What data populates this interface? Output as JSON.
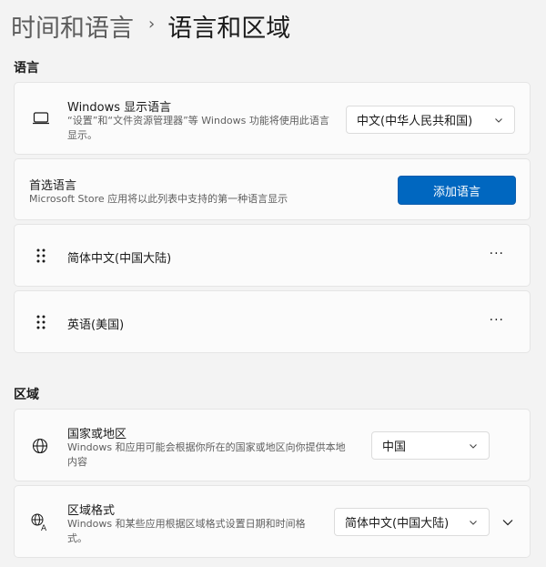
{
  "breadcrumb": {
    "parent": "时间和语言",
    "separator": "›",
    "current": "语言和区域"
  },
  "language_section": {
    "label": "语言",
    "display_language": {
      "title": "Windows 显示语言",
      "description": "“设置”和“文件资源管理器”等 Windows 功能将使用此语言显示。",
      "selected": "中文(中华人民共和国)",
      "icon": "monitor-icon"
    },
    "preferred": {
      "title": "首选语言",
      "description": "Microsoft Store 应用将以此列表中支持的第一种语言显示",
      "add_button": "添加语言"
    },
    "languages": [
      {
        "name": "简体中文(中国大陆)",
        "more": "···"
      },
      {
        "name": "英语(美国)",
        "more": "···"
      }
    ]
  },
  "region_section": {
    "label": "区域",
    "country": {
      "title": "国家或地区",
      "description": "Windows 和应用可能会根据你所在的国家或地区向你提供本地内容",
      "selected": "中国",
      "icon": "globe-icon"
    },
    "format": {
      "title": "区域格式",
      "description": "Windows 和某些应用根据区域格式设置日期和时间格式。",
      "selected": "简体中文(中国大陆)",
      "icon": "language-region-icon"
    }
  },
  "colors": {
    "accent": "#0067c0",
    "background": "#f3f3f3",
    "card": "#fbfbfb"
  }
}
